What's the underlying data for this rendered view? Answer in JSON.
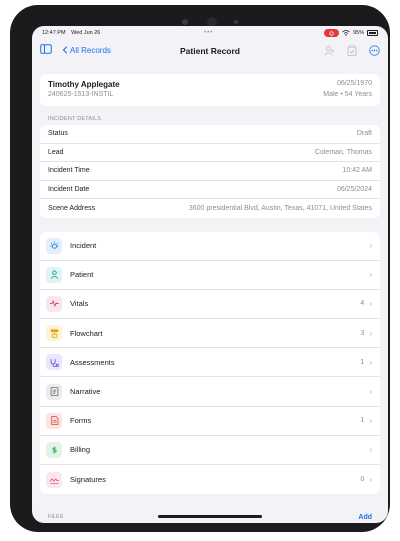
{
  "status_bar": {
    "time": "12:47 PM",
    "date": "Wed Jun 26",
    "battery": "95%"
  },
  "nav": {
    "back_label": "All Records",
    "title": "Patient Record"
  },
  "patient": {
    "name": "Timothy Applegate",
    "record_id": "240625-1513-INSTIL",
    "dob": "06/25/1970",
    "sex_age": "Male • 54 Years"
  },
  "incident_details": {
    "section_label": "INCIDENT DETAILS",
    "rows": [
      {
        "label": "Status",
        "value": "Draft"
      },
      {
        "label": "Lead",
        "value": "Coleman, Thomas"
      },
      {
        "label": "Incident Time",
        "value": "10:42 AM"
      },
      {
        "label": "Incident Date",
        "value": "06/25/2024"
      },
      {
        "label": "Scene Address",
        "value": "3600 presidential Blvd, Austin, Texas, 41071, United States"
      }
    ]
  },
  "sections": [
    {
      "label": "Incident",
      "count": "",
      "icon": "incident-icon",
      "color": "#1e88e5",
      "bg": "#e3f0fc"
    },
    {
      "label": "Patient",
      "count": "",
      "icon": "patient-icon",
      "color": "#1fa6a0",
      "bg": "#e0f4f3"
    },
    {
      "label": "Vitals",
      "count": "4",
      "icon": "vitals-icon",
      "color": "#e0487a",
      "bg": "#fbe6ee"
    },
    {
      "label": "Flowchart",
      "count": "3",
      "icon": "flowchart-icon",
      "color": "#e0a800",
      "bg": "#fdf4d8"
    },
    {
      "label": "Assessments",
      "count": "1",
      "icon": "assessments-icon",
      "color": "#5b4fd6",
      "bg": "#e9e7fb"
    },
    {
      "label": "Narrative",
      "count": "",
      "icon": "narrative-icon",
      "color": "#6e6e73",
      "bg": "#ececef"
    },
    {
      "label": "Forms",
      "count": "1",
      "icon": "forms-icon",
      "color": "#e0483a",
      "bg": "#fbe4e2"
    },
    {
      "label": "Billing",
      "count": "",
      "icon": "billing-icon",
      "color": "#2eaa4f",
      "bg": "#e2f4e7"
    },
    {
      "label": "Signatures",
      "count": "0",
      "icon": "signatures-icon",
      "color": "#e0487a",
      "bg": "#fbe6ee"
    }
  ],
  "files": {
    "section_label": "FILES",
    "add_label": "Add"
  }
}
